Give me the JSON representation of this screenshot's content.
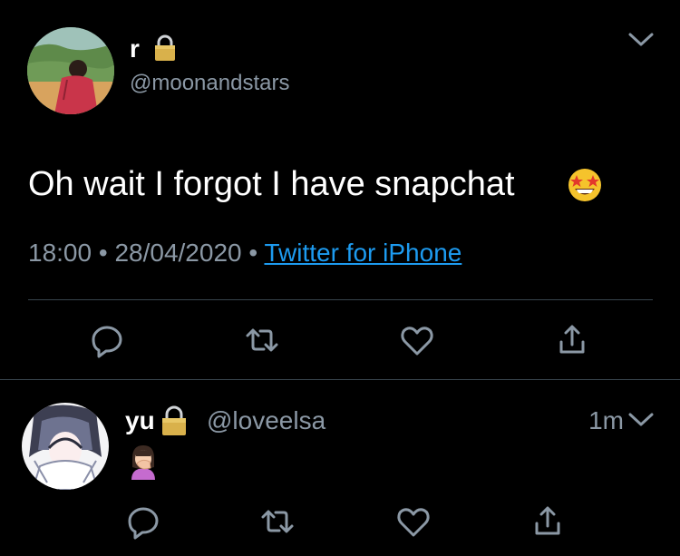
{
  "tweet": {
    "display_name": "r",
    "handle": "@moonandstars",
    "text": "Oh wait I forgot I have snapchat",
    "emoji_icon": "star-struck-emoji",
    "time": "18:00",
    "separator": "•",
    "date": "28/04/2020",
    "source": "Twitter for iPhone",
    "locked_icon": "lock-icon",
    "menu_icon": "chevron-down-icon"
  },
  "actions": [
    "reply-icon",
    "retweet-icon",
    "like-icon",
    "share-icon"
  ],
  "reply": {
    "display_name": "yu",
    "handle": "@loveelsa",
    "time_ago": "1m",
    "emoji_icon": "woman-facepalming-emoji",
    "locked_icon": "lock-icon",
    "menu_icon": "chevron-down-icon"
  },
  "colors": {
    "background": "#000000",
    "primary_text": "#ffffff",
    "secondary_text": "#8b98a5",
    "link": "#1d9bf0",
    "divider": "#38444d",
    "icon": "#8b98a5"
  }
}
